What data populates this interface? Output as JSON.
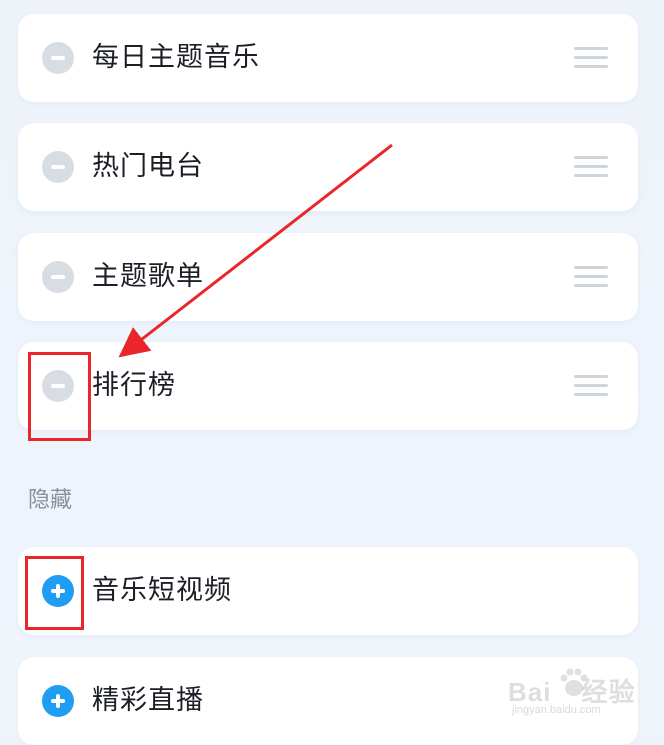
{
  "visible_items": [
    {
      "label": "每日主题音乐",
      "action": "remove"
    },
    {
      "label": "热门电台",
      "action": "remove"
    },
    {
      "label": "主题歌单",
      "action": "remove"
    },
    {
      "label": "排行榜",
      "action": "remove"
    }
  ],
  "hidden_section": {
    "label": "隐藏"
  },
  "hidden_items": [
    {
      "label": "音乐短视频",
      "action": "add"
    },
    {
      "label": "精彩直播",
      "action": "add"
    }
  ],
  "icons": {
    "remove": "minus-circle-icon",
    "add": "plus-circle-icon",
    "drag": "drag-handle-icon"
  },
  "colors": {
    "remove_button": "#d8dce3",
    "add_button": "#1e9df2",
    "annotation": "#e8262c"
  },
  "watermark": {
    "brand": "Bai",
    "brand_suffix": "经验",
    "url": "jingyan.baidu.com"
  }
}
